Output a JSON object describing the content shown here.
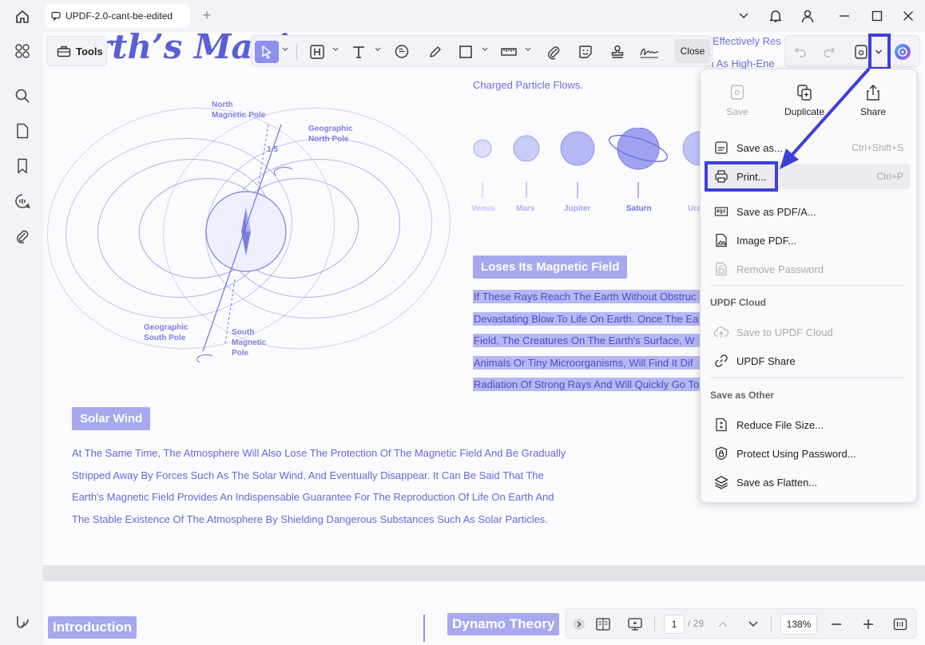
{
  "tab": {
    "title": "UPDF-2.0-cant-be-edited",
    "new_tab": "+"
  },
  "tools_label": "Tools",
  "toolbar": {
    "close_label": "Close"
  },
  "document": {
    "title_fragment": "rth’s Magi",
    "right_lines": [
      "Effectively Res",
      "ch As High-Ene",
      "Charged Particle Flows."
    ],
    "planets": [
      "Venus",
      "Mars",
      "Jupiter",
      "Saturn",
      "Ura"
    ],
    "diagram_labels": {
      "north_magnetic": [
        "North",
        "Magnetic Pole"
      ],
      "geo_north": [
        "Geographic",
        "North Pole"
      ],
      "angle": "1.5",
      "geo_south": [
        "Geographic",
        "South Pole"
      ],
      "south_magnetic": [
        "South",
        "Magnetic",
        "Pole"
      ]
    },
    "tag_loses": "Loses Its Magnetic Field",
    "highlighted_lines": [
      "If These Rays Reach The Earth Without Obstruc",
      "Devastating Blow To Life On Earth. Once The Ea",
      "Field, The Creatures On The Earth's Surface, W",
      "Animals Or Tiny Microorganisms, Will Find It Dif",
      "Radiation Of Strong Rays And Will Quickly Go To"
    ],
    "tag_solar": "Solar Wind",
    "paragraph": [
      "At The Same Time, The Atmosphere Will Also Lose The Protection Of The Magnetic Field And Be Gradually",
      "Stripped Away By Forces Such As The Solar Wind, And Eventually Disappear. It Can Be Said That The",
      "Earth's Magnetic Field Provides An Indispensable Guarantee For The Reproduction Of Life On Earth And",
      "The Stable Existence Of The Atmosphere By Shielding Dangerous Substances Such As Solar Particles."
    ],
    "page2_tag_intro": "Introduction",
    "page2_tag_dynamo": "Dynamo Theory"
  },
  "menu": {
    "top": {
      "save": "Save",
      "duplicate": "Duplicate",
      "share": "Share"
    },
    "items": {
      "save_as": {
        "label": "Save as...",
        "shortcut": "Ctrl+Shift+S"
      },
      "print": {
        "label": "Print...",
        "shortcut": "Ctrl+P"
      },
      "save_pdfa": {
        "label": "Save as PDF/A..."
      },
      "image_pdf": {
        "label": "Image PDF..."
      },
      "remove_password": {
        "label": "Remove Password"
      },
      "save_cloud": {
        "label": "Save to UPDF Cloud"
      },
      "updf_share": {
        "label": "UPDF Share"
      },
      "reduce": {
        "label": "Reduce File Size..."
      },
      "protect": {
        "label": "Protect Using Password..."
      },
      "flatten": {
        "label": "Save as Flatten..."
      }
    },
    "sections": {
      "cloud": "UPDF Cloud",
      "other": "Save as Other"
    }
  },
  "bottombar": {
    "page_current": "1",
    "page_total": "/ 29",
    "zoom": "138%"
  },
  "colors": {
    "accent": "#5b5fd6",
    "highlight_box": "#3d3fd9",
    "tag": "#a7a9ef"
  }
}
